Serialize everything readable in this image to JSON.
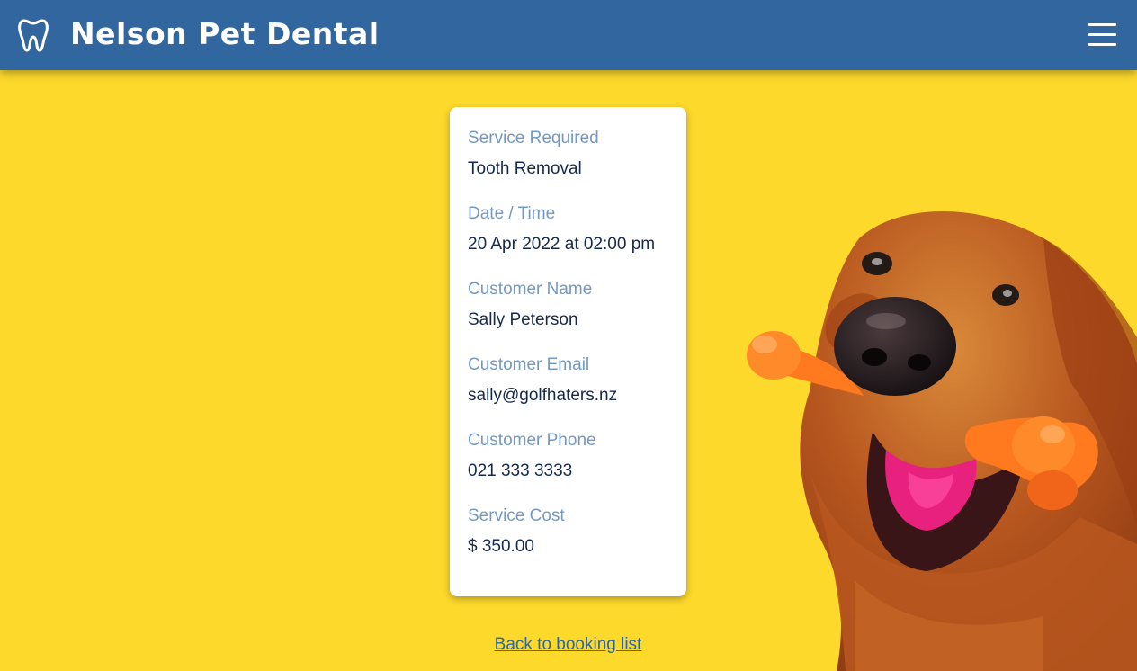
{
  "header": {
    "brand": "Nelson Pet Dental",
    "logo_icon": "tooth-icon",
    "menu_icon": "hamburger-menu-icon",
    "background_color": "#31669e"
  },
  "booking": {
    "fields": [
      {
        "label": "Service Required",
        "value": "Tooth Removal"
      },
      {
        "label": "Date / Time",
        "value": "20 Apr 2022 at 02:00 pm"
      },
      {
        "label": "Customer Name",
        "value": "Sally Peterson"
      },
      {
        "label": "Customer Email",
        "value": "sally@golfhaters.nz"
      },
      {
        "label": "Customer Phone",
        "value": "021 333 3333"
      },
      {
        "label": "Service Cost",
        "value": "$ 350.00"
      }
    ]
  },
  "back_link": "Back to booking list",
  "colors": {
    "page_background": "#fdd92c",
    "label": "#7399c4",
    "value": "#16294a"
  }
}
